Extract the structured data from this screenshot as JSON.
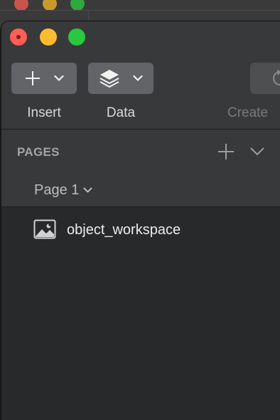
{
  "toolbar": {
    "insert_label": "Insert",
    "data_label": "Data",
    "create_label": "Create"
  },
  "pages_panel": {
    "title": "PAGES",
    "current_page": "Page 1"
  },
  "layers": [
    {
      "name": "object_workspace",
      "icon": "image-icon"
    }
  ],
  "colors": {
    "close": "#fc5f57",
    "minimize": "#fdbc2e",
    "maximize": "#29c840",
    "toolbar_bg": "#38393b",
    "sidebar_bg": "#28292b"
  }
}
